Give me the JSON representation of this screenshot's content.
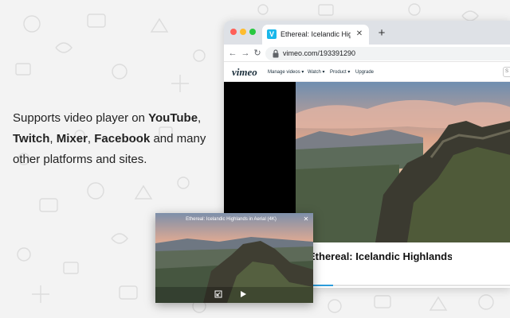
{
  "promo": {
    "line1_text": "Supports video player on ",
    "brand_youtube": "YouTube",
    "sep1": ",",
    "brand_twitch": "Twitch",
    "sep2": ", ",
    "brand_mixer": "Mixer",
    "sep3": ", ",
    "brand_facebook": "Facebook",
    "line_end": " and many other platforms and sites."
  },
  "browser": {
    "tab": {
      "favicon_letter": "V",
      "title": "Ethereal: Icelandic Highlands in Aerial",
      "close_glyph": "✕"
    },
    "newtab_glyph": "+",
    "nav": {
      "back_glyph": "←",
      "forward_glyph": "→",
      "reload_glyph": "↻"
    },
    "url": "vimeo.com/193391290",
    "site": {
      "logo": "vimeo",
      "menu": [
        "Manage videos ▾",
        "Watch ▾",
        "Product ▾",
        "Upgrade"
      ],
      "search_glyph": "S"
    },
    "video_title": "Ethereal: Icelandic Highlands in Aerial",
    "progress_fraction": 0.38
  },
  "pip": {
    "title": "Ethereal: Icelandic Highlands in Aerial (4K)",
    "close_glyph": "✕",
    "icons": {
      "back": "back-to-tab-icon",
      "play": "play-icon"
    }
  },
  "colors": {
    "background": "#f3f3f3",
    "tabbar": "#dee1e6",
    "progress": "#2d9cdb",
    "vimeo_blue": "#1ab7ea"
  }
}
